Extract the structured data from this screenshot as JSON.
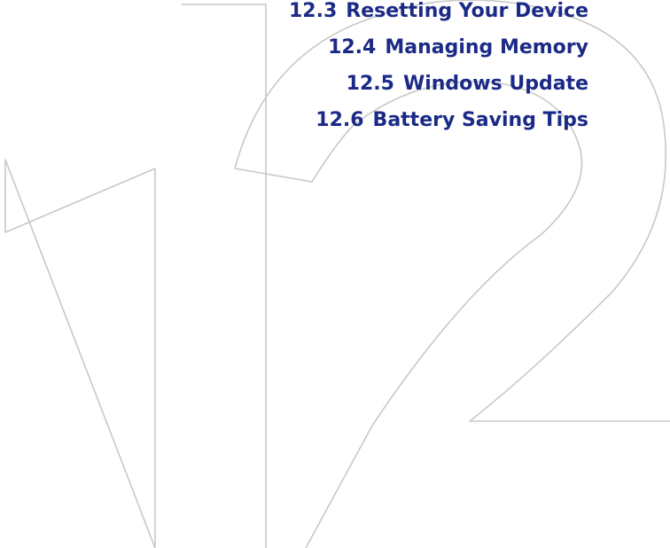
{
  "toc": {
    "items": [
      {
        "number": "12.3",
        "title": "Resetting Your Device"
      },
      {
        "number": "12.4",
        "title": "Managing Memory"
      },
      {
        "number": "12.5",
        "title": "Windows Update"
      },
      {
        "number": "12.6",
        "title": "Battery Saving Tips"
      }
    ]
  },
  "colors": {
    "heading_text": "#1b2a86",
    "numeral_outline": "#c8c8c8",
    "background": "#ffffff"
  }
}
